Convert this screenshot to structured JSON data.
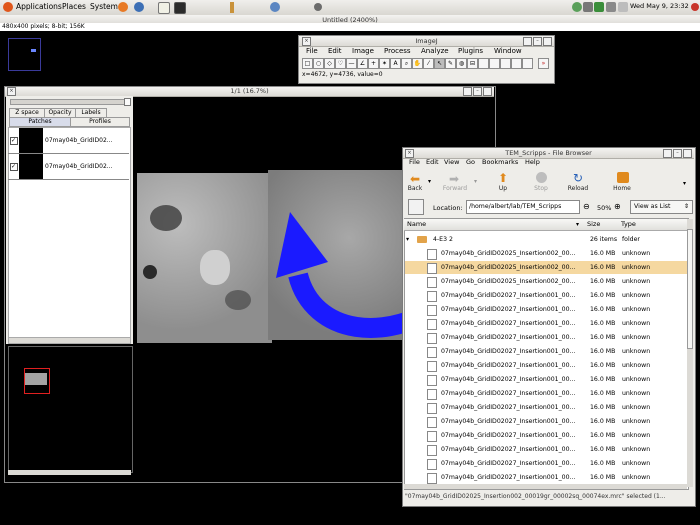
{
  "panel": {
    "menus": [
      "Applications",
      "Places",
      "System"
    ],
    "clock": "Wed May  9, 23:32"
  },
  "desktop": {
    "window_title": "Untitled (2400%)",
    "info_line": "480x400 pixels; 8-bit; 156K"
  },
  "imagej": {
    "title": "ImageJ",
    "menus": [
      "File",
      "Edit",
      "Image",
      "Process",
      "Analyze",
      "Plugins",
      "Window"
    ],
    "status": "x=4672, y=4736, value=0"
  },
  "trakem": {
    "canvas_label": "1/1  (16.7%)",
    "tabs": [
      "Z space",
      "Opacity",
      "Labels"
    ],
    "subtabs": [
      "Patches",
      "Profiles"
    ],
    "patches": [
      "07may04b_GridID02...",
      "07may04b_GridID02..."
    ]
  },
  "filebrowser": {
    "title": "TEM_Scripps - File Browser",
    "menus": [
      "File",
      "Edit",
      "View",
      "Go",
      "Bookmarks",
      "Help"
    ],
    "toolbar": [
      "Back",
      "Forward",
      "Up",
      "Stop",
      "Reload",
      "Home"
    ],
    "location_label": "Location:",
    "location_value": "/home/albert/lab/TEM_Scripps",
    "zoom": "50%",
    "view_mode": "View as List",
    "columns": [
      "Name",
      "Size",
      "Type"
    ],
    "folder": {
      "name": "4-E3 2",
      "size": "26 items",
      "type": "folder"
    },
    "files": [
      {
        "name": "07may04b_GridID02025_Insertion002_00...",
        "size": "16.0 MB",
        "type": "unknown"
      },
      {
        "name": "07may04b_GridID02025_Insertion002_00...",
        "size": "16.0 MB",
        "type": "unknown"
      },
      {
        "name": "07may04b_GridID02025_Insertion002_00...",
        "size": "16.0 MB",
        "type": "unknown"
      },
      {
        "name": "07may04b_GridID02027_Insertion001_00...",
        "size": "16.0 MB",
        "type": "unknown"
      },
      {
        "name": "07may04b_GridID02027_Insertion001_00...",
        "size": "16.0 MB",
        "type": "unknown"
      },
      {
        "name": "07may04b_GridID02027_Insertion001_00...",
        "size": "16.0 MB",
        "type": "unknown"
      },
      {
        "name": "07may04b_GridID02027_Insertion001_00...",
        "size": "16.0 MB",
        "type": "unknown"
      },
      {
        "name": "07may04b_GridID02027_Insertion001_00...",
        "size": "16.0 MB",
        "type": "unknown"
      },
      {
        "name": "07may04b_GridID02027_Insertion001_00...",
        "size": "16.0 MB",
        "type": "unknown"
      },
      {
        "name": "07may04b_GridID02027_Insertion001_00...",
        "size": "16.0 MB",
        "type": "unknown"
      },
      {
        "name": "07may04b_GridID02027_Insertion001_00...",
        "size": "16.0 MB",
        "type": "unknown"
      },
      {
        "name": "07may04b_GridID02027_Insertion001_00...",
        "size": "16.0 MB",
        "type": "unknown"
      },
      {
        "name": "07may04b_GridID02027_Insertion001_00...",
        "size": "16.0 MB",
        "type": "unknown"
      },
      {
        "name": "07may04b_GridID02027_Insertion001_00...",
        "size": "16.0 MB",
        "type": "unknown"
      },
      {
        "name": "07may04b_GridID02027_Insertion001_00...",
        "size": "16.0 MB",
        "type": "unknown"
      },
      {
        "name": "07may04b_GridID02027_Insertion001_00...",
        "size": "16.0 MB",
        "type": "unknown"
      },
      {
        "name": "07may04b_GridID02027_Insertion001_00...",
        "size": "16.0 MB",
        "type": "unknown"
      }
    ],
    "selected_index": 1,
    "status": "\"07may04b_GridID02025_Insertion002_00019gr_00002sq_00074ex.mrc\" selected (1..."
  },
  "colors": {
    "selection": "#f5d8a0",
    "arrow": "#1a1aff",
    "folder": "#e2a34a"
  }
}
